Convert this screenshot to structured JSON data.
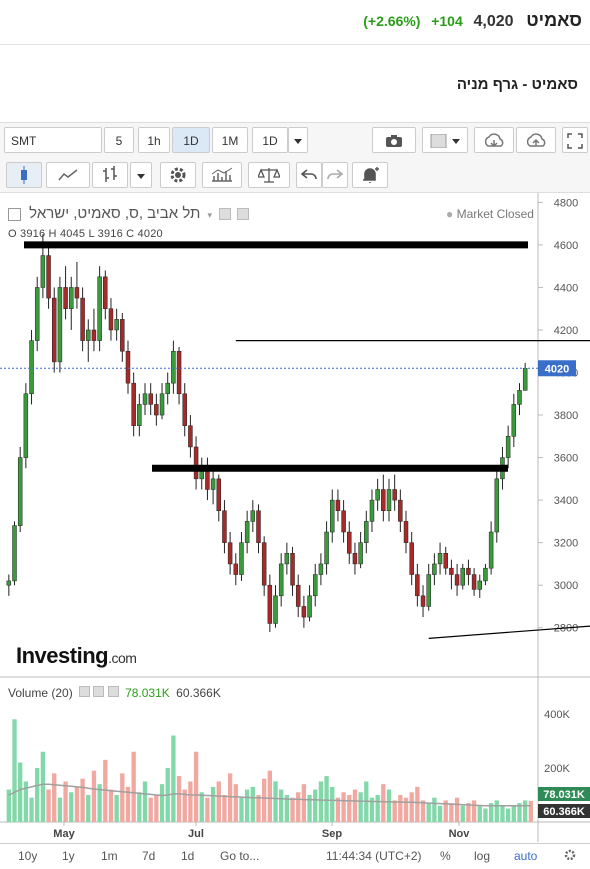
{
  "header": {
    "name": "סאמיט",
    "last": "4,020",
    "change": "+104",
    "change_pct": "(+2.66%)",
    "chart_title": "סאמיט - גרף מניה"
  },
  "toolbar": {
    "symbol": "SMT",
    "intervals": [
      "5",
      "1h",
      "1D",
      "1M"
    ],
    "active_interval": "1D",
    "interval_select": "1D"
  },
  "chart_data": {
    "type": "candlestick",
    "title": "תל אביב ,ס, סאמיט, ישראל",
    "ohlc_label": "O 3916  H 4045  L 3916  C 4020",
    "status": "Market Closed",
    "last_value_label": "4020",
    "last_value": 4020,
    "y_ticks": [
      2800,
      3000,
      3200,
      3400,
      3600,
      3800,
      4000,
      4200,
      4400,
      4600,
      4800
    ],
    "ylim": [
      2620,
      4830
    ],
    "x_ticks": [
      "May",
      "Jul",
      "Sep",
      "Nov"
    ],
    "drawn_levels": [
      4600,
      3550
    ],
    "drawn_lines": [
      {
        "from": [
          40,
          4150
        ],
        "to": [
          165,
          4150
        ]
      },
      {
        "from": [
          74,
          2750
        ],
        "to": [
          180,
          2965
        ]
      }
    ],
    "candles": [
      [
        3000,
        3050,
        2950,
        3020
      ],
      [
        3020,
        3300,
        3000,
        3280
      ],
      [
        3280,
        3650,
        3250,
        3600
      ],
      [
        3600,
        3950,
        3550,
        3900
      ],
      [
        3900,
        4200,
        3850,
        4150
      ],
      [
        4150,
        4450,
        4100,
        4400
      ],
      [
        4400,
        4650,
        4350,
        4550
      ],
      [
        4550,
        4600,
        4300,
        4350
      ],
      [
        4350,
        4400,
        4000,
        4050
      ],
      [
        4050,
        4450,
        4000,
        4400
      ],
      [
        4400,
        4500,
        4250,
        4300
      ],
      [
        4300,
        4450,
        4200,
        4400
      ],
      [
        4400,
        4520,
        4300,
        4350
      ],
      [
        4350,
        4400,
        4100,
        4150
      ],
      [
        4150,
        4250,
        4050,
        4200
      ],
      [
        4200,
        4300,
        4100,
        4150
      ],
      [
        4150,
        4500,
        4100,
        4450
      ],
      [
        4450,
        4480,
        4250,
        4300
      ],
      [
        4300,
        4350,
        4150,
        4200
      ],
      [
        4200,
        4300,
        4150,
        4250
      ],
      [
        4250,
        4280,
        4050,
        4100
      ],
      [
        4100,
        4150,
        3900,
        3950
      ],
      [
        3950,
        4000,
        3700,
        3750
      ],
      [
        3750,
        3900,
        3700,
        3850
      ],
      [
        3850,
        3950,
        3800,
        3900
      ],
      [
        3900,
        3950,
        3800,
        3850
      ],
      [
        3850,
        3900,
        3750,
        3800
      ],
      [
        3800,
        3950,
        3780,
        3900
      ],
      [
        3900,
        4000,
        3850,
        3950
      ],
      [
        3950,
        4150,
        3900,
        4100
      ],
      [
        4100,
        4120,
        3850,
        3900
      ],
      [
        3900,
        3950,
        3700,
        3750
      ],
      [
        3750,
        3800,
        3600,
        3650
      ],
      [
        3650,
        3700,
        3450,
        3500
      ],
      [
        3500,
        3600,
        3450,
        3550
      ],
      [
        3550,
        3600,
        3400,
        3450
      ],
      [
        3450,
        3550,
        3380,
        3500
      ],
      [
        3500,
        3520,
        3300,
        3350
      ],
      [
        3350,
        3400,
        3150,
        3200
      ],
      [
        3200,
        3250,
        3050,
        3100
      ],
      [
        3100,
        3150,
        3000,
        3050
      ],
      [
        3050,
        3250,
        3020,
        3200
      ],
      [
        3200,
        3350,
        3150,
        3300
      ],
      [
        3300,
        3400,
        3250,
        3350
      ],
      [
        3350,
        3380,
        3150,
        3200
      ],
      [
        3200,
        3230,
        2950,
        3000
      ],
      [
        3000,
        3050,
        2780,
        2820
      ],
      [
        2820,
        3000,
        2800,
        2950
      ],
      [
        2950,
        3150,
        2900,
        3100
      ],
      [
        3100,
        3200,
        3050,
        3150
      ],
      [
        3150,
        3180,
        2950,
        3000
      ],
      [
        3000,
        3050,
        2850,
        2900
      ],
      [
        2900,
        2950,
        2800,
        2850
      ],
      [
        2850,
        3000,
        2830,
        2950
      ],
      [
        2950,
        3100,
        2900,
        3050
      ],
      [
        3050,
        3150,
        3000,
        3100
      ],
      [
        3100,
        3300,
        3050,
        3250
      ],
      [
        3250,
        3450,
        3200,
        3400
      ],
      [
        3400,
        3450,
        3300,
        3350
      ],
      [
        3350,
        3400,
        3200,
        3250
      ],
      [
        3250,
        3300,
        3100,
        3150
      ],
      [
        3150,
        3200,
        3050,
        3100
      ],
      [
        3100,
        3250,
        3080,
        3200
      ],
      [
        3200,
        3350,
        3150,
        3300
      ],
      [
        3300,
        3450,
        3250,
        3400
      ],
      [
        3400,
        3500,
        3350,
        3450
      ],
      [
        3450,
        3520,
        3300,
        3350
      ],
      [
        3350,
        3500,
        3300,
        3450
      ],
      [
        3450,
        3520,
        3350,
        3400
      ],
      [
        3400,
        3450,
        3250,
        3300
      ],
      [
        3300,
        3350,
        3150,
        3200
      ],
      [
        3200,
        3250,
        3000,
        3050
      ],
      [
        3050,
        3100,
        2900,
        2950
      ],
      [
        2950,
        3000,
        2850,
        2900
      ],
      [
        2900,
        3100,
        2880,
        3050
      ],
      [
        3050,
        3150,
        3000,
        3100
      ],
      [
        3100,
        3200,
        3050,
        3150
      ],
      [
        3150,
        3180,
        3050,
        3080
      ],
      [
        3080,
        3120,
        2980,
        3050
      ],
      [
        3050,
        3100,
        2950,
        3000
      ],
      [
        3000,
        3100,
        2980,
        3080
      ],
      [
        3080,
        3120,
        3000,
        3050
      ],
      [
        3050,
        3080,
        2950,
        2980
      ],
      [
        2980,
        3050,
        2940,
        3020
      ],
      [
        3020,
        3100,
        3000,
        3080
      ],
      [
        3080,
        3300,
        3050,
        3250
      ],
      [
        3250,
        3550,
        3200,
        3500
      ],
      [
        3500,
        3650,
        3450,
        3600
      ],
      [
        3600,
        3750,
        3550,
        3700
      ],
      [
        3700,
        3900,
        3650,
        3850
      ],
      [
        3850,
        3950,
        3800,
        3916
      ],
      [
        3916,
        4045,
        3916,
        4020
      ]
    ],
    "volume": {
      "label": "Volume (20)",
      "value_label": "78.031K",
      "ma_label": "60.366K",
      "y_ticks": [
        "400K",
        "200K"
      ],
      "ylim": [
        0,
        470000
      ],
      "values": [
        120000,
        380000,
        220000,
        150000,
        90000,
        200000,
        260000,
        120000,
        180000,
        90000,
        150000,
        110000,
        130000,
        160000,
        100000,
        190000,
        140000,
        230000,
        120000,
        100000,
        180000,
        130000,
        260000,
        110000,
        150000,
        90000,
        100000,
        140000,
        200000,
        320000,
        170000,
        120000,
        150000,
        260000,
        110000,
        90000,
        130000,
        150000,
        100000,
        180000,
        140000,
        90000,
        120000,
        130000,
        100000,
        160000,
        190000,
        150000,
        120000,
        100000,
        90000,
        110000,
        140000,
        100000,
        120000,
        150000,
        170000,
        130000,
        90000,
        110000,
        100000,
        120000,
        110000,
        150000,
        90000,
        100000,
        140000,
        120000,
        80000,
        100000,
        90000,
        110000,
        130000,
        80000,
        70000,
        90000,
        60000,
        80000,
        70000,
        90000,
        60000,
        70000,
        80000,
        60000,
        50000,
        70000,
        80000,
        60000,
        50000,
        60000,
        70000,
        80000,
        78031
      ],
      "ma": [
        100000,
        110000,
        120000,
        125000,
        130000,
        135000,
        140000,
        140000,
        138000,
        136000,
        134000,
        132000,
        130000,
        128000,
        125000,
        122000,
        120000,
        118000,
        116000,
        114000,
        112000,
        110000,
        108000,
        106000,
        104000,
        102000,
        100000,
        98000,
        100000,
        104000,
        104000,
        102000,
        100000,
        100000,
        99000,
        98000,
        97000,
        96000,
        95000,
        94000,
        93000,
        92000,
        91000,
        90000,
        90000,
        89000,
        88000,
        87000,
        86000,
        85000,
        84000,
        84000,
        83000,
        82000,
        82000,
        81000,
        81000,
        80000,
        80000,
        79000,
        78000,
        78000,
        77000,
        77000,
        76000,
        76000,
        75000,
        75000,
        74000,
        74000,
        73000,
        73000,
        72000,
        71000,
        70000,
        69000,
        68000,
        67000,
        66000,
        65000,
        64000,
        63000,
        62000,
        61000,
        60000,
        60000,
        60000,
        60000,
        60000,
        60000,
        60200,
        60300,
        60366
      ],
      "up_color": "#82d8a8",
      "down_color": "#f0a8a0",
      "ma_color": "#a0a0a0"
    },
    "colors": {
      "up": "#3b9a3b",
      "down": "#a52a2a",
      "last_label_bg": "#3a6fc9"
    }
  },
  "watermark": {
    "name": "Investing",
    "suffix": ".com"
  },
  "bottom_bar": {
    "ranges": [
      "10y",
      "1y",
      "1m",
      "7d",
      "1d"
    ],
    "goto": "Go to...",
    "time": "11:44:34 (UTC+2)",
    "pct": "%",
    "log": "log",
    "auto": "auto"
  }
}
